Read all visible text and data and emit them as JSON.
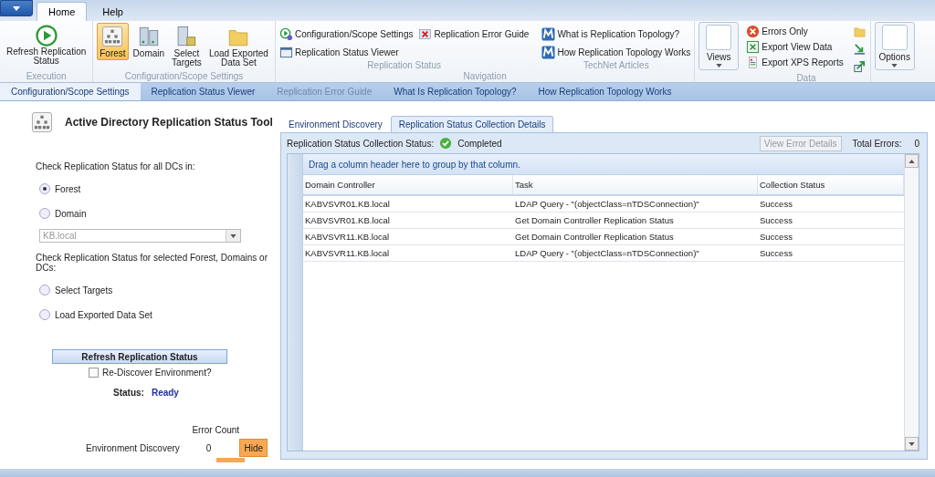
{
  "ribbon_tabs": [
    {
      "label": "Home",
      "selected": true
    },
    {
      "label": "Help",
      "selected": false
    }
  ],
  "ribbon_groups": [
    {
      "kind": "large",
      "label": "Execution",
      "items": [
        {
          "label": "Refresh Replication\nStatus"
        }
      ]
    },
    {
      "kind": "large",
      "label": "Configuration/Scope Settings",
      "items": [
        {
          "label": "Forest",
          "selected": true
        },
        {
          "label": "Domain",
          "selected": false
        },
        {
          "label": "Select\nTargets",
          "selected": false
        },
        {
          "label": "Load Exported\nData Set",
          "selected": false
        }
      ]
    },
    {
      "kind": "nav",
      "label": "Navigation",
      "subgroups": [
        {
          "label": "Replication Status",
          "items": [
            {
              "label": "Configuration/Scope Settings"
            },
            {
              "label": "Replication Error Guide"
            },
            {
              "label": "Replication Status Viewer"
            }
          ]
        },
        {
          "label": "TechNet Articles",
          "items": [
            {
              "label": "What is Replication Topology?"
            },
            {
              "label": "How Replication Topology Works"
            }
          ]
        }
      ]
    },
    {
      "kind": "menu",
      "items": [
        {
          "label": "Views"
        }
      ]
    },
    {
      "kind": "data",
      "label": "Data",
      "items": [
        {
          "label": "Errors Only"
        },
        {
          "label": "Export View Data"
        },
        {
          "label": "Export XPS Reports"
        }
      ]
    },
    {
      "kind": "menu",
      "items": [
        {
          "label": "Options"
        }
      ]
    }
  ],
  "nav_links": [
    {
      "label": "Configuration/Scope Settings",
      "selected": true,
      "disabled": false
    },
    {
      "label": "Replication Status Viewer",
      "selected": false,
      "disabled": false
    },
    {
      "label": "Replication Error Guide",
      "selected": false,
      "disabled": true
    },
    {
      "label": "What Is Replication Topology?",
      "selected": false,
      "disabled": false
    },
    {
      "label": "How Replication Topology Works",
      "selected": false,
      "disabled": false
    }
  ],
  "tool": {
    "title": "Active Directory Replication Status Tool",
    "all_dcs_prompt": "Check Replication Status for all DCs in:",
    "scope_options": [
      {
        "label": "Forest",
        "selected": true
      },
      {
        "label": "Domain",
        "selected": false
      }
    ],
    "domain_select": {
      "value": "KB.local",
      "disabled": true
    },
    "selected_prompt": "Check Replication Status for selected Forest, Domains or DCs:",
    "target_options": [
      {
        "label": "Select Targets",
        "selected": false
      },
      {
        "label": "Load Exported Data Set",
        "selected": false
      }
    ],
    "refresh_button": "Refresh Replication Status",
    "rediscover": {
      "label": "Re-Discover Environment?",
      "checked": false
    },
    "status_label": "Status:",
    "status_value": "Ready",
    "error_count_header": "Error Count",
    "error_rows": [
      {
        "label": "Environment Discovery",
        "count": "0",
        "button": "Hide"
      }
    ]
  },
  "detail_tabs": [
    {
      "label": "Environment Discovery",
      "selected": false
    },
    {
      "label": "Replication Status Collection Details",
      "selected": true
    }
  ],
  "collection": {
    "label": "Replication Status Collection Status:",
    "status": "Completed",
    "view_errors_button": {
      "label": "View Error Details",
      "disabled": true
    },
    "total_errors_label": "Total Errors:",
    "total_errors": "0"
  },
  "grid": {
    "group_hint": "Drag a column header here to group by that column.",
    "columns": [
      "Domain Controller",
      "Task",
      "Collection Status"
    ],
    "rows": [
      [
        "KABVSVR01.KB.local",
        "LDAP Query - \"(objectClass=nTDSConnection)\"",
        "Success"
      ],
      [
        "KABVSVR01.KB.local",
        "Get Domain Controller Replication Status",
        "Success"
      ],
      [
        "KABVSVR11.KB.local",
        "Get Domain Controller Replication Status",
        "Success"
      ],
      [
        "KABVSVR11.KB.local",
        "LDAP Query - \"(objectClass=nTDSConnection)\"",
        "Success"
      ]
    ]
  }
}
